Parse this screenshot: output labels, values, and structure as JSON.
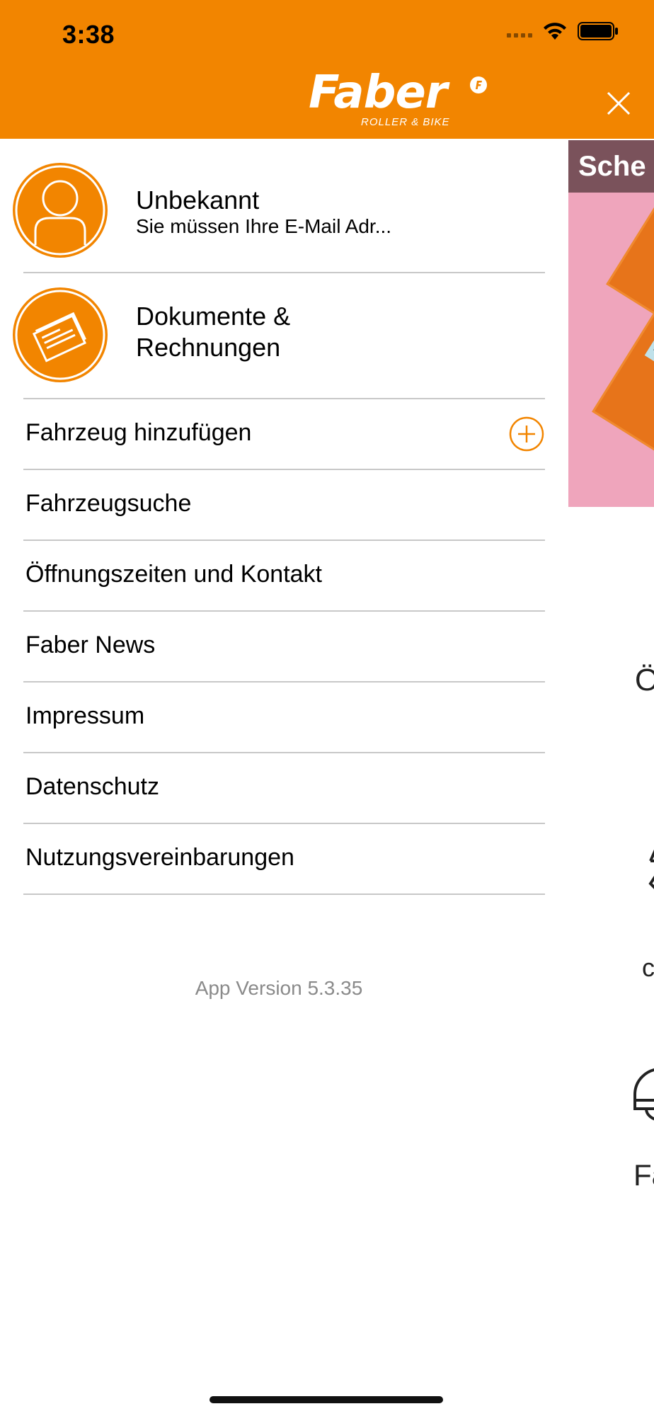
{
  "status_bar": {
    "time": "3:38"
  },
  "header": {
    "logo_text": "Faber",
    "logo_subtitle": "ROLLER & BIKE",
    "brand_color": "#f28500"
  },
  "drawer": {
    "profile": {
      "name": "Unbekannt",
      "subtitle": "Sie müssen Ihre E-Mail Adr..."
    },
    "documents": {
      "label_line1": "Dokumente &",
      "label_line2": "Rechnungen"
    },
    "menu_items": [
      {
        "label": "Fahrzeug hinzufügen",
        "icon": "plus-circle-icon"
      },
      {
        "label": "Fahrzeugsuche"
      },
      {
        "label": "Öffnungszeiten und Kontakt"
      },
      {
        "label": "Faber News"
      },
      {
        "label": "Impressum"
      },
      {
        "label": "Datenschutz"
      },
      {
        "label": "Nutzungsvereinbarungen"
      }
    ],
    "app_version": "App Version 5.3.35"
  },
  "background": {
    "promo_title": "Sche",
    "text_1": "Ö",
    "text_2": "c",
    "text_3": "Fa"
  }
}
